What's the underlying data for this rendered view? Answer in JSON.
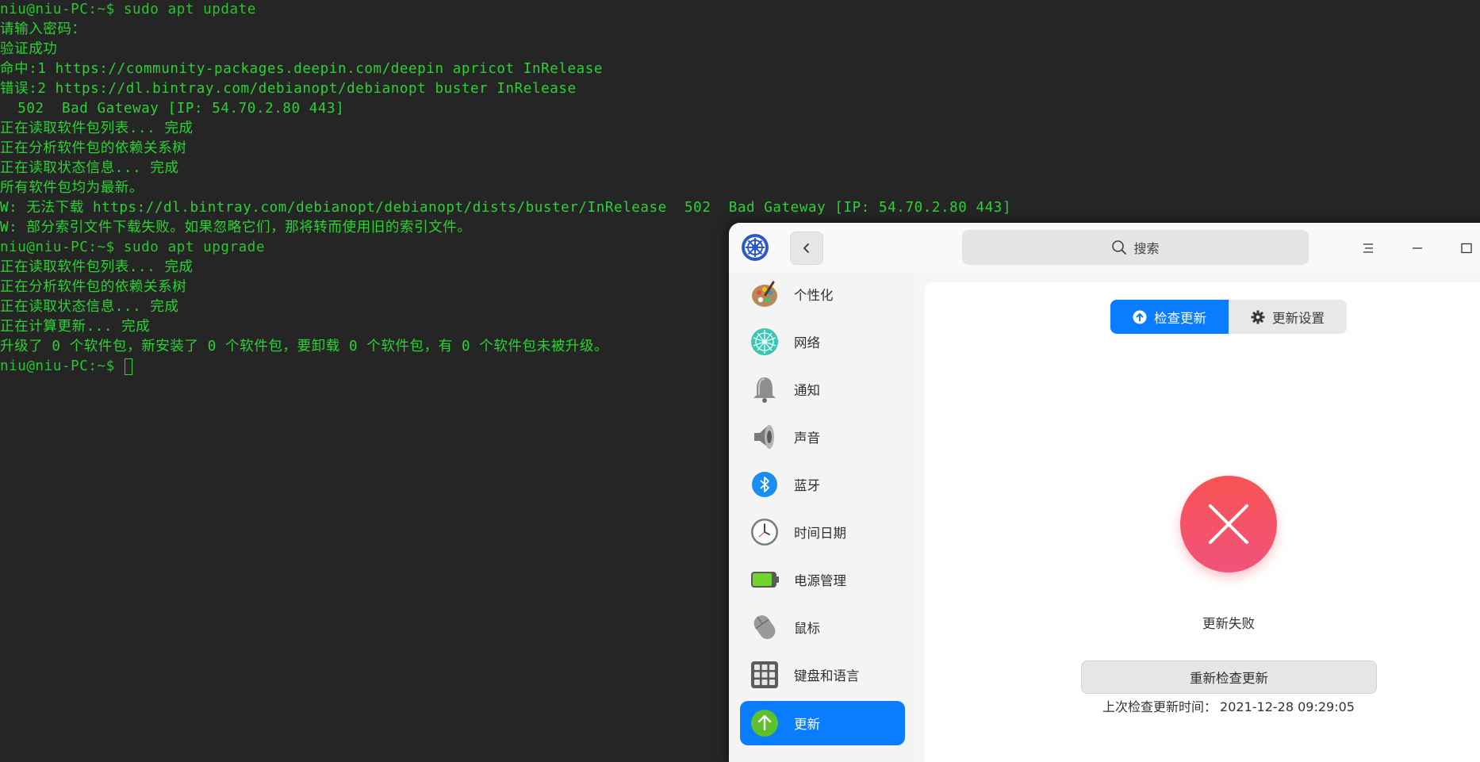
{
  "terminal": {
    "lines": [
      "niu@niu-PC:~$ sudo apt update",
      "请输入密码：",
      "验证成功",
      "命中:1 https://community-packages.deepin.com/deepin apricot InRelease",
      "错误:2 https://dl.bintray.com/debianopt/debianopt buster InRelease",
      "  502  Bad Gateway [IP: 54.70.2.80 443]",
      "正在读取软件包列表... 完成",
      "正在分析软件包的依赖关系树",
      "正在读取状态信息... 完成",
      "所有软件包均为最新。",
      "W: 无法下载 https://dl.bintray.com/debianopt/debianopt/dists/buster/InRelease  502  Bad Gateway [IP: 54.70.2.80 443]",
      "W: 部分索引文件下载失败。如果忽略它们，那将转而使用旧的索引文件。",
      "niu@niu-PC:~$ sudo apt upgrade",
      "正在读取软件包列表... 完成",
      "正在分析软件包的依赖关系树",
      "正在读取状态信息... 完成",
      "正在计算更新... 完成",
      "升级了 0 个软件包，新安装了 0 个软件包，要卸载 0 个软件包，有 0 个软件包未被升级。",
      "niu@niu-PC:~$ "
    ],
    "text_color": "#2bd233",
    "background": "#252525"
  },
  "window": {
    "app_icon": "control-center-logo-icon",
    "search_placeholder": "搜索",
    "buttons": {
      "back": "chevron-left-icon",
      "menu": "menu-icon",
      "minimize": "minimize-icon",
      "maximize": "maximize-icon"
    },
    "sidebar": [
      {
        "label": "个性化",
        "icon": "personalization-icon"
      },
      {
        "label": "网络",
        "icon": "network-icon"
      },
      {
        "label": "通知",
        "icon": "bell-icon"
      },
      {
        "label": "声音",
        "icon": "speaker-icon"
      },
      {
        "label": "蓝牙",
        "icon": "bluetooth-icon"
      },
      {
        "label": "时间日期",
        "icon": "clock-icon"
      },
      {
        "label": "电源管理",
        "icon": "battery-icon"
      },
      {
        "label": "鼠标",
        "icon": "mouse-icon"
      },
      {
        "label": "键盘和语言",
        "icon": "keyboard-icon"
      },
      {
        "label": "更新",
        "icon": "update-arrow-icon",
        "active": true
      }
    ],
    "tabs": {
      "check_update": "检查更新",
      "update_settings": "更新设置"
    },
    "status": {
      "message": "更新失败",
      "icon": "error-x-icon"
    },
    "recheck_button": "重新检查更新",
    "last_check_label": "上次检查更新时间：",
    "last_check_time": "2021-12-28 09:29:05",
    "accent_color": "#0a7cff",
    "error_color": "#f25464"
  }
}
